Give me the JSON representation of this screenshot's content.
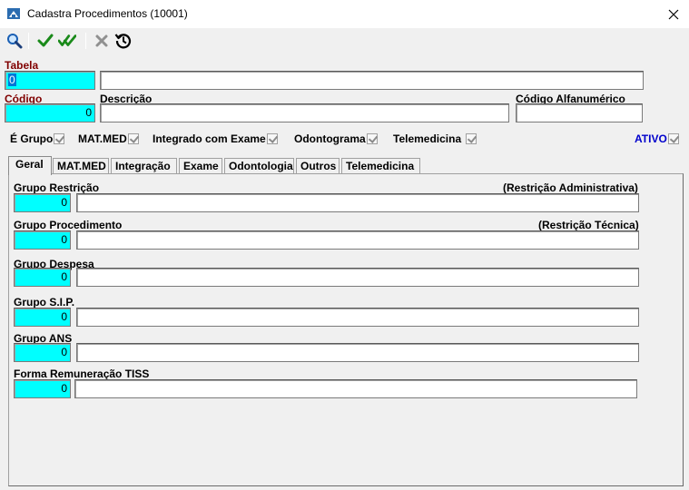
{
  "window": {
    "title": "Cadastra Procedimentos (10001)"
  },
  "toolbar": {
    "buttons": [
      {
        "name": "search-icon",
        "color": "#1a5fb4"
      },
      {
        "name": "confirm-check-icon",
        "color": "#1a8a1a"
      },
      {
        "name": "confirm-all-double-check-icon",
        "color": "#1a8a1a"
      },
      {
        "name": "cancel-x-icon",
        "color": "#909090"
      },
      {
        "name": "history-icon",
        "color": "#000000"
      }
    ]
  },
  "header": {
    "tabela_label": "Tabela",
    "tabela_value": "0",
    "tabela_desc_value": "",
    "codigo_label": "Código",
    "codigo_value": "0",
    "descricao_label": "Descrição",
    "descricao_value": "",
    "codigo_alfa_label": "Código Alfanumérico",
    "codigo_alfa_value": ""
  },
  "flags": [
    {
      "label": "É Grupo",
      "checked": true
    },
    {
      "label": "MAT.MED",
      "checked": true
    },
    {
      "label": "Integrado com Exame",
      "checked": true
    },
    {
      "label": "Odontograma",
      "checked": true
    },
    {
      "label": "Telemedicina",
      "checked": true
    },
    {
      "label": "ATIVO",
      "checked": true
    }
  ],
  "tabs": [
    "Geral",
    "MAT.MED",
    "Integração",
    "Exame",
    "Odontologia",
    "Outros",
    "Telemedicina"
  ],
  "active_tab": "Geral",
  "geral": {
    "grupo_restricao_label": "Grupo Restrição",
    "grupo_restricao_hint": "(Restrição Administrativa)",
    "grupo_restricao_code": "0",
    "grupo_restricao_desc": "",
    "grupo_procedimento_label": "Grupo Procedimento",
    "grupo_procedimento_hint": "(Restrição Técnica)",
    "grupo_procedimento_code": "0",
    "grupo_procedimento_desc": "",
    "grupo_despesa_label": "Grupo Despesa",
    "grupo_despesa_code": "0",
    "grupo_despesa_desc": "",
    "grupo_sip_label": "Grupo S.I.P.",
    "grupo_sip_code": "0",
    "grupo_sip_desc": "",
    "grupo_ans_label": "Grupo ANS",
    "grupo_ans_code": "0",
    "grupo_ans_desc": "",
    "forma_remuneracao_label": "Forma Remuneração TISS",
    "forma_remuneracao_code": "0",
    "forma_remuneracao_desc": ""
  },
  "colors": {
    "required_label": "#800000",
    "ativo_label": "#0000cc",
    "key_field_bg": "#00ffff"
  }
}
